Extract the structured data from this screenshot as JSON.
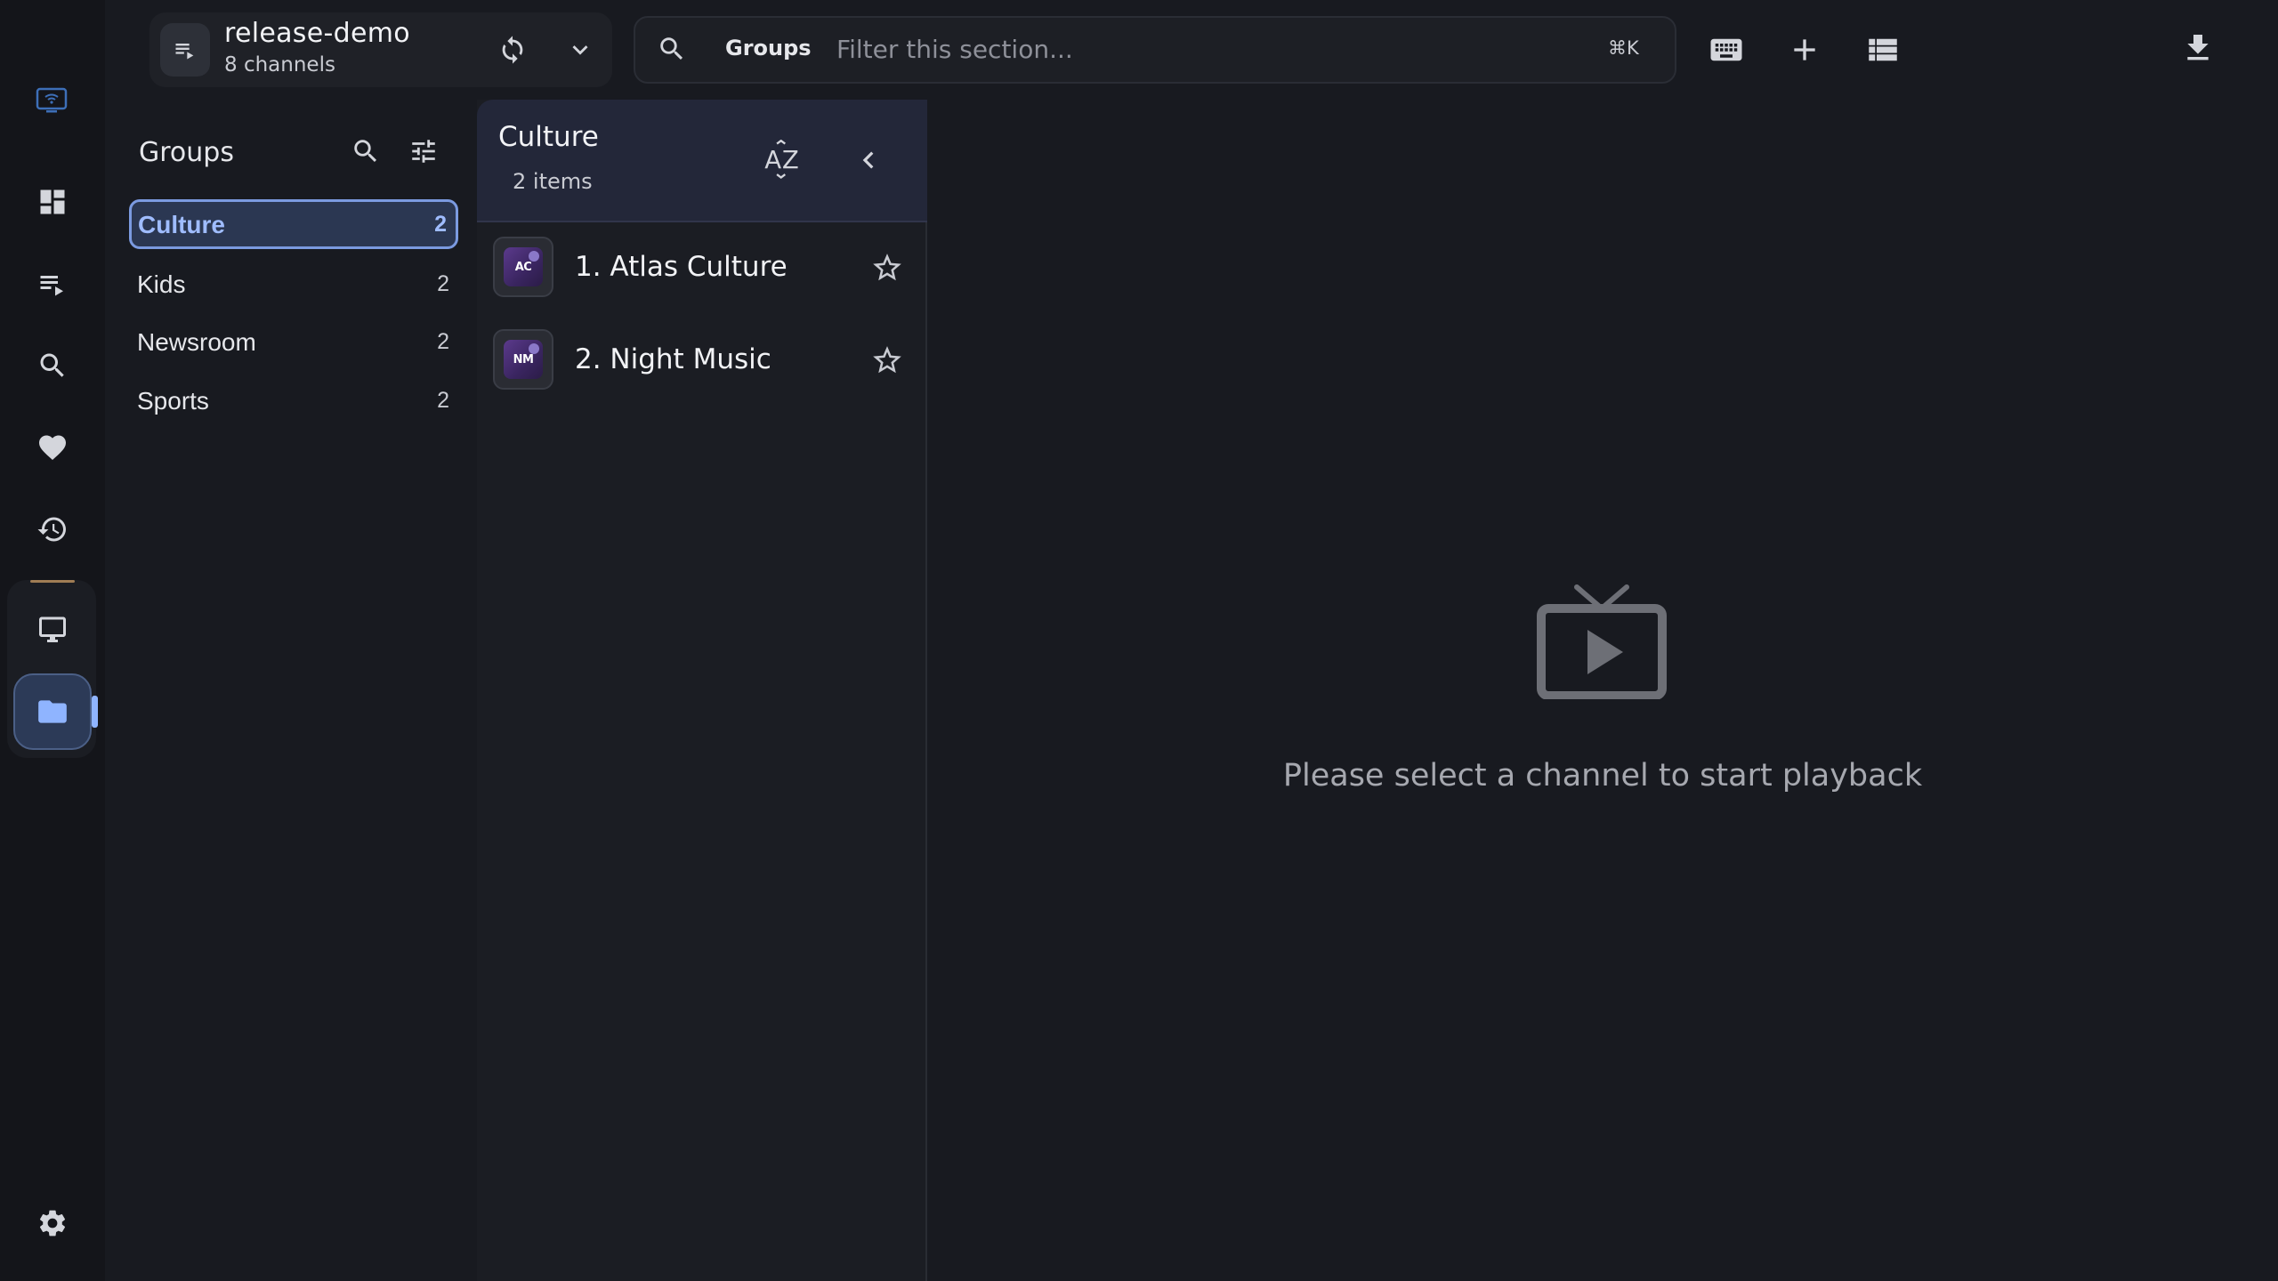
{
  "topbar": {
    "playlist_name": "release-demo",
    "playlist_channels": "8 channels",
    "search_scope": "Groups",
    "search_placeholder": "Filter this section...",
    "shortcut": "⌘K"
  },
  "rail": {
    "items": [
      "dashboard",
      "playlists",
      "search",
      "favorites",
      "history",
      "live-tv",
      "groups"
    ],
    "active": "groups"
  },
  "groups": {
    "title": "Groups",
    "items": [
      {
        "label": "Culture",
        "count": "2",
        "active": true
      },
      {
        "label": "Kids",
        "count": "2",
        "active": false
      },
      {
        "label": "Newsroom",
        "count": "2",
        "active": false
      },
      {
        "label": "Sports",
        "count": "2",
        "active": false
      }
    ]
  },
  "channels": {
    "title": "Culture",
    "subtitle": "2 items",
    "items": [
      {
        "name": "1. Atlas Culture",
        "logo_text": "AC"
      },
      {
        "name": "2. Night Music",
        "logo_text": "NM"
      }
    ]
  },
  "player": {
    "empty_message": "Please select a channel to start playback"
  },
  "colors": {
    "background": "#181a20",
    "accent": "#8fb4ff",
    "active_bg": "#2b3752",
    "muted_icon": "#6d6f76"
  }
}
